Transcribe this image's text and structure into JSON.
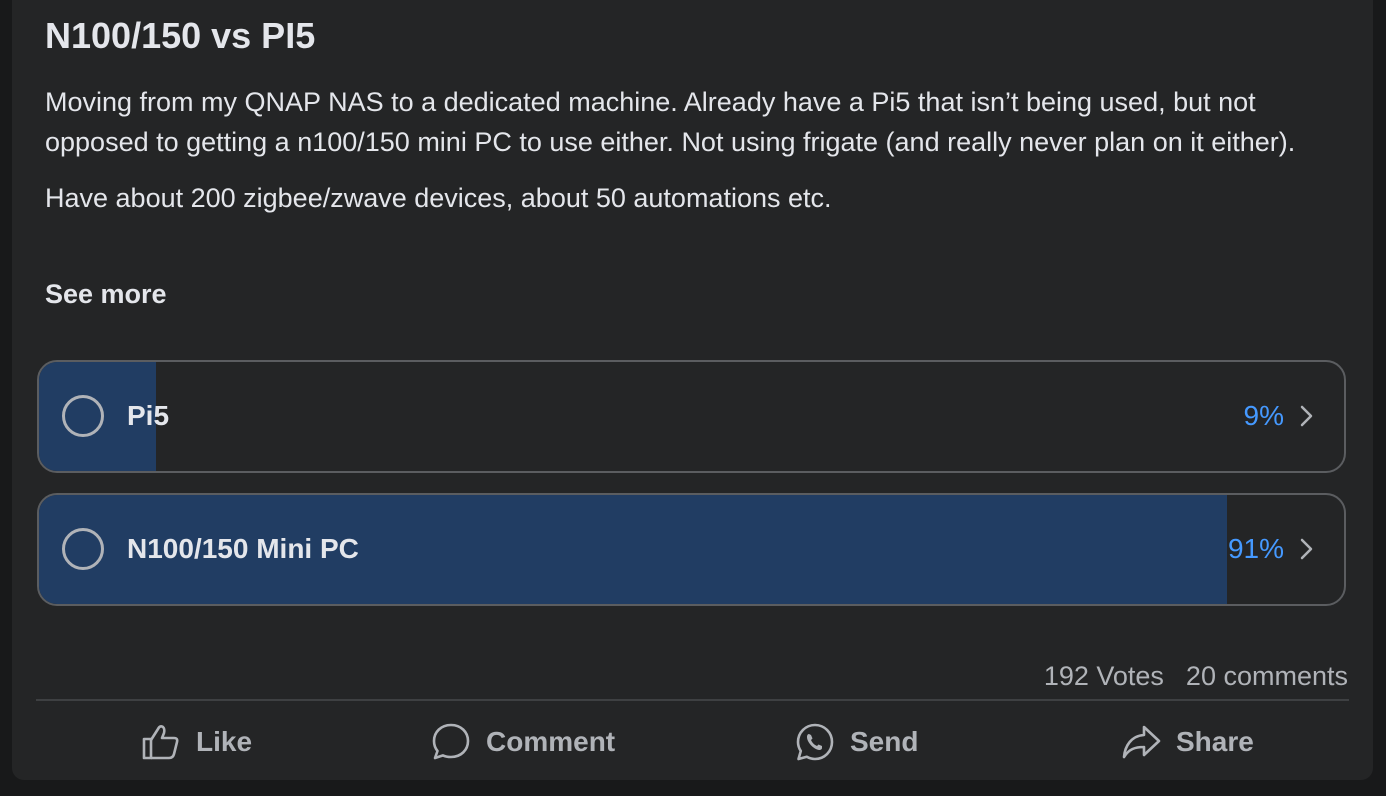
{
  "post": {
    "title": "N100/150 vs PI5",
    "paragraphs": [
      "Moving from my QNAP NAS to a dedicated machine. Already have a Pi5 that isn’t being used, but not opposed to getting a n100/150 mini PC to use either. Not using frigate (and really never plan on it either).",
      "Have about 200 zigbee/zwave devices, about 50 automations etc."
    ],
    "see_more": "See more"
  },
  "poll": {
    "options": [
      {
        "label": "Pi5",
        "percent_text": "9%",
        "fill_fraction": 0.09
      },
      {
        "label": "N100/150 Mini PC",
        "percent_text": "91%",
        "fill_fraction": 0.91
      }
    ],
    "fill_color": "#213d63",
    "percent_color": "#4599ff"
  },
  "stats": {
    "votes": "192 Votes",
    "comments": "20 comments"
  },
  "actions": [
    {
      "label": "Like",
      "icon": "thumbs-up-icon"
    },
    {
      "label": "Comment",
      "icon": "comment-bubble-icon"
    },
    {
      "label": "Send",
      "icon": "whatsapp-icon"
    },
    {
      "label": "Share",
      "icon": "share-arrow-icon"
    }
  ]
}
